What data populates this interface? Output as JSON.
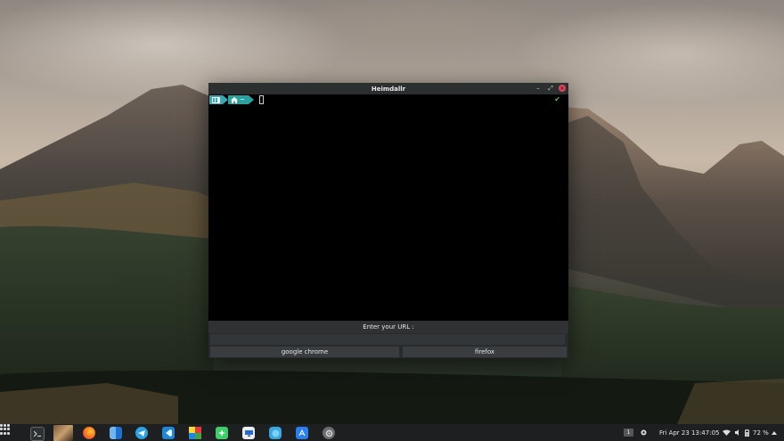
{
  "window": {
    "title": "Heimdallr",
    "controls": {
      "minimize": "–",
      "maximize": "⤢",
      "close": "✕"
    }
  },
  "terminal": {
    "prompt_folder_icon": "folder-icon",
    "prompt_home_icon": "home-icon",
    "prompt_path": "~",
    "status_icon": "check-icon",
    "status_glyph": "✔"
  },
  "url_panel": {
    "label": "Enter your URL :",
    "input_value": "",
    "input_placeholder": ""
  },
  "buttons": {
    "chrome": "google chrome",
    "firefox": "firefox"
  },
  "taskbar": {
    "apps": [
      {
        "name": "app-launcher",
        "icon": "grid-icon"
      },
      {
        "name": "terminal",
        "icon": "terminal-icon"
      },
      {
        "name": "photo-viewer",
        "icon": "picture-icon"
      },
      {
        "name": "firefox",
        "icon": "firefox-icon"
      },
      {
        "name": "files",
        "icon": "finder-icon"
      },
      {
        "name": "telegram",
        "icon": "telegram-icon"
      },
      {
        "name": "vscode",
        "icon": "vscode-icon"
      },
      {
        "name": "colors",
        "icon": "color-grid-icon"
      },
      {
        "name": "puzzle",
        "icon": "puzzle-icon"
      },
      {
        "name": "monitor",
        "icon": "monitor-icon"
      },
      {
        "name": "browser",
        "icon": "globe-icon"
      },
      {
        "name": "app-store",
        "icon": "appstore-icon"
      },
      {
        "name": "settings",
        "icon": "gear-icon"
      }
    ],
    "workspace": "1",
    "datetime": "Fri Apr 23  13:47:05",
    "battery": "72 %"
  },
  "colors": {
    "titlebar": "#2c2f30",
    "prompt_folder": "#3aa7b3",
    "prompt_home": "#2aa3a0",
    "status_ok": "#58c15a",
    "close": "#e0455a"
  }
}
